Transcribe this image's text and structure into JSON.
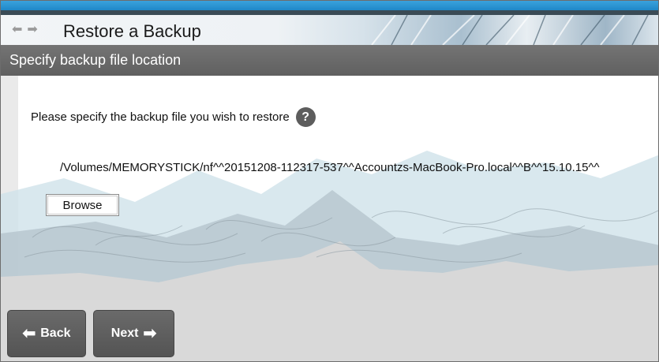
{
  "header": {
    "title": "Restore a Backup",
    "back_arrow_glyph": "⬅",
    "forward_arrow_glyph": "➡"
  },
  "section": {
    "title": "Specify backup file location"
  },
  "main": {
    "prompt": "Please specify the backup file you wish to restore",
    "help_glyph": "?",
    "file_path": "/Volumes/MEMORYSTICK/nf^^20151208-112317-537^^Accountzs-MacBook-Pro.local^^B^^15.10.15^^",
    "browse_label": "Browse"
  },
  "footer": {
    "back_label": "Back",
    "back_icon_glyph": "⬅",
    "next_label": "Next",
    "next_icon_glyph": "➡"
  },
  "icons": {
    "back_arrow": "arrow-left-icon",
    "forward_arrow": "arrow-right-icon",
    "help": "help-icon"
  },
  "colors": {
    "top_strip": "#2a95d3",
    "section_bar": "#6a6a6a",
    "footer_button": "#5e5e5e",
    "help_icon": "#5d5d5d"
  }
}
